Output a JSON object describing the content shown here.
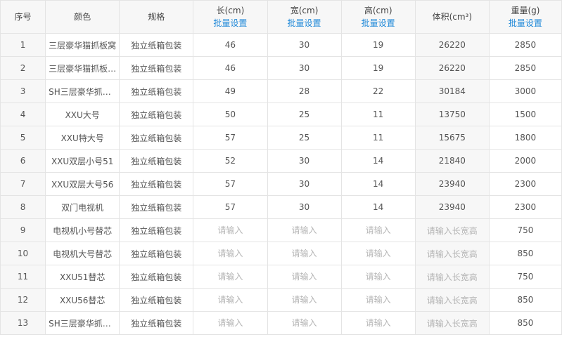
{
  "table": {
    "headers": {
      "no": "序号",
      "color": "颜色",
      "spec": "规格",
      "length": "长(cm)",
      "width": "宽(cm)",
      "height": "高(cm)",
      "volume": "体积(cm³)",
      "weight": "重量(g)",
      "batch_label": "批量设置"
    },
    "placeholders": {
      "dimension": "请输入",
      "volume": "请输入长宽高"
    },
    "rows": [
      {
        "no": "1",
        "color": "三层豪华猫抓板窝",
        "spec": "独立纸箱包装",
        "length": "46",
        "width": "30",
        "height": "19",
        "volume": "26220",
        "weight": "2850"
      },
      {
        "no": "2",
        "color": "三层豪华猫抓板窝...",
        "spec": "独立纸箱包装",
        "length": "46",
        "width": "30",
        "height": "19",
        "volume": "26220",
        "weight": "2850"
      },
      {
        "no": "3",
        "color": "SH三层豪华抓板...",
        "spec": "独立纸箱包装",
        "length": "49",
        "width": "28",
        "height": "22",
        "volume": "30184",
        "weight": "3000"
      },
      {
        "no": "4",
        "color": "XXU大号",
        "spec": "独立纸箱包装",
        "length": "50",
        "width": "25",
        "height": "11",
        "volume": "13750",
        "weight": "1500"
      },
      {
        "no": "5",
        "color": "XXU特大号",
        "spec": "独立纸箱包装",
        "length": "57",
        "width": "25",
        "height": "11",
        "volume": "15675",
        "weight": "1800"
      },
      {
        "no": "6",
        "color": "XXU双层小号51",
        "spec": "独立纸箱包装",
        "length": "52",
        "width": "30",
        "height": "14",
        "volume": "21840",
        "weight": "2000"
      },
      {
        "no": "7",
        "color": "XXU双层大号56",
        "spec": "独立纸箱包装",
        "length": "57",
        "width": "30",
        "height": "14",
        "volume": "23940",
        "weight": "2300"
      },
      {
        "no": "8",
        "color": "双门电视机",
        "spec": "独立纸箱包装",
        "length": "57",
        "width": "30",
        "height": "14",
        "volume": "23940",
        "weight": "2300"
      },
      {
        "no": "9",
        "color": "电视机小号替芯",
        "spec": "独立纸箱包装",
        "length": "",
        "width": "",
        "height": "",
        "volume": "",
        "weight": "750"
      },
      {
        "no": "10",
        "color": "电视机大号替芯",
        "spec": "独立纸箱包装",
        "length": "",
        "width": "",
        "height": "",
        "volume": "",
        "weight": "850"
      },
      {
        "no": "11",
        "color": "XXU51替芯",
        "spec": "独立纸箱包装",
        "length": "",
        "width": "",
        "height": "",
        "volume": "",
        "weight": "750"
      },
      {
        "no": "12",
        "color": "XXU56替芯",
        "spec": "独立纸箱包装",
        "length": "",
        "width": "",
        "height": "",
        "volume": "",
        "weight": "850"
      },
      {
        "no": "13",
        "color": "SH三层豪华抓板...",
        "spec": "独立纸箱包装",
        "length": "",
        "width": "",
        "height": "",
        "volume": "",
        "weight": "850"
      }
    ]
  }
}
